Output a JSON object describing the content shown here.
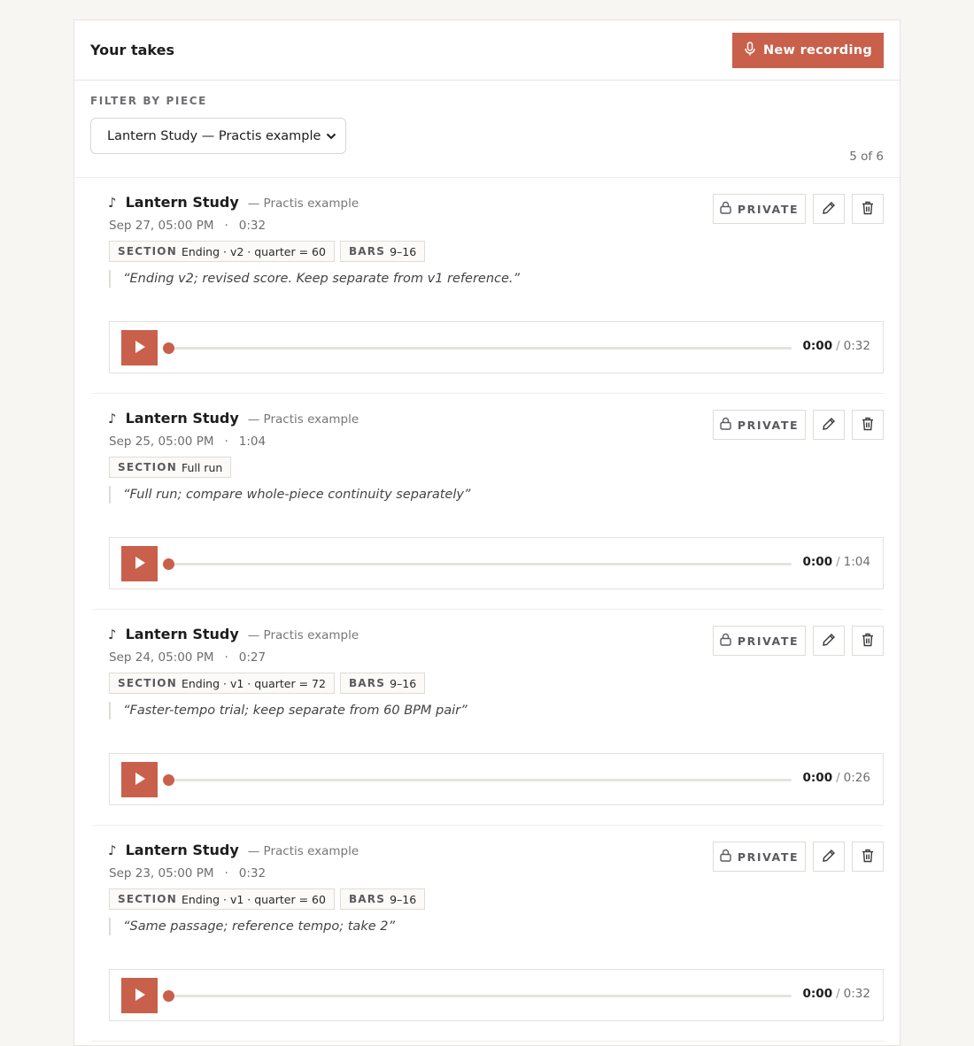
{
  "header": {
    "title": "Your takes",
    "new_recording_label": "New recording"
  },
  "filter": {
    "label": "FILTER BY PIECE",
    "selected": "Lantern Study — Practis example",
    "count_text": "5 of 6"
  },
  "accent_color": "#c9604c",
  "takes": [
    {
      "piece": "Lantern Study",
      "subtitle": "— Practis example",
      "date": "Sep 27, 05:00 PM",
      "duration": "0:32",
      "section_label": "SECTION",
      "section_value": "Ending · v2 · quarter = 60",
      "bars_label": "BARS",
      "bars_value": "9–16",
      "note": "“Ending v2; revised score. Keep separate from v1 reference.”",
      "visibility": "PRIVATE",
      "time_current": "0:00",
      "time_total": "0:32"
    },
    {
      "piece": "Lantern Study",
      "subtitle": "— Practis example",
      "date": "Sep 25, 05:00 PM",
      "duration": "1:04",
      "section_label": "SECTION",
      "section_value": "Full run",
      "bars_label": "",
      "bars_value": "",
      "note": "“Full run; compare whole-piece continuity separately”",
      "visibility": "PRIVATE",
      "time_current": "0:00",
      "time_total": "1:04"
    },
    {
      "piece": "Lantern Study",
      "subtitle": "— Practis example",
      "date": "Sep 24, 05:00 PM",
      "duration": "0:27",
      "section_label": "SECTION",
      "section_value": "Ending · v1 · quarter = 72",
      "bars_label": "BARS",
      "bars_value": "9–16",
      "note": "“Faster-tempo trial; keep separate from 60 BPM pair”",
      "visibility": "PRIVATE",
      "time_current": "0:00",
      "time_total": "0:26"
    },
    {
      "piece": "Lantern Study",
      "subtitle": "— Practis example",
      "date": "Sep 23, 05:00 PM",
      "duration": "0:32",
      "section_label": "SECTION",
      "section_value": "Ending · v1 · quarter = 60",
      "bars_label": "BARS",
      "bars_value": "9–16",
      "note": "“Same passage; reference tempo; take 2”",
      "visibility": "PRIVATE",
      "time_current": "0:00",
      "time_total": "0:32"
    }
  ]
}
